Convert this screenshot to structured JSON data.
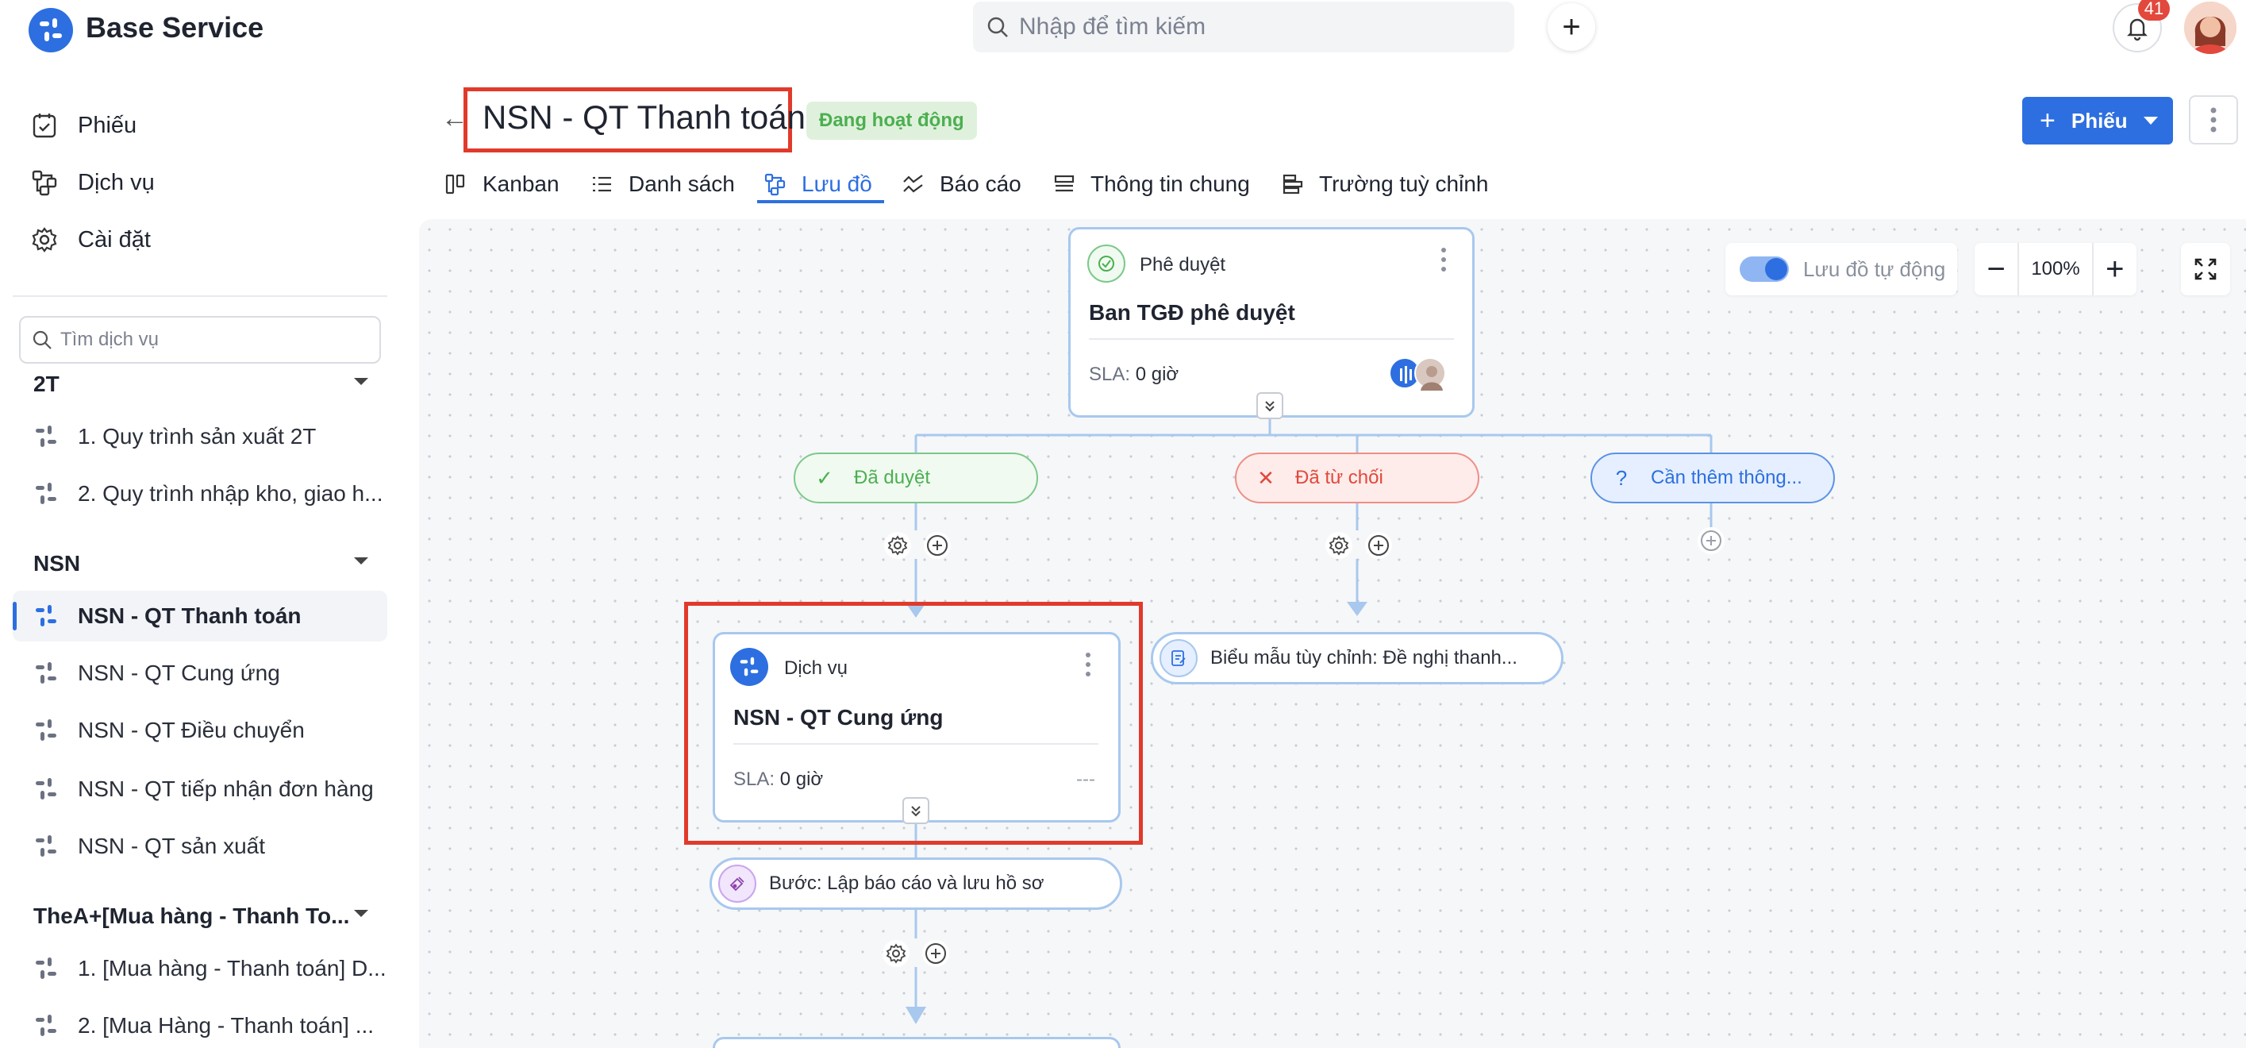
{
  "app": {
    "title": "Base Service"
  },
  "search": {
    "placeholder": "Nhập để tìm kiếm"
  },
  "notifications": {
    "count": "41"
  },
  "sidebar": {
    "nav": [
      {
        "label": "Phiếu",
        "icon": "ticket-icon"
      },
      {
        "label": "Dịch vụ",
        "icon": "service-icon"
      },
      {
        "label": "Cài đặt",
        "icon": "gear-icon"
      }
    ],
    "search_placeholder": "Tìm dịch vụ",
    "groups": [
      {
        "name": "2T",
        "items": [
          "1. Quy trình sản xuất 2T",
          "2. Quy trình nhập kho, giao h..."
        ]
      },
      {
        "name": "NSN",
        "items": [
          "NSN - QT Thanh toán",
          "NSN - QT Cung ứng",
          "NSN - QT Điều chuyển",
          "NSN - QT tiếp nhận đơn hàng",
          "NSN - QT sản xuất"
        ]
      },
      {
        "name": "TheA+[Mua hàng - Thanh To...",
        "items": [
          "1. [Mua hàng - Thanh toán] D...",
          "2. [Mua Hàng - Thanh toán] ..."
        ]
      }
    ],
    "active_item": "NSN - QT Thanh toán"
  },
  "header": {
    "title": "NSN - QT Thanh toán",
    "status": "Đang hoạt động",
    "primary_button": "Phiếu"
  },
  "tabs": [
    {
      "label": "Kanban",
      "icon": "kanban-icon"
    },
    {
      "label": "Danh sách",
      "icon": "list-icon"
    },
    {
      "label": "Lưu đồ",
      "icon": "flow-icon"
    },
    {
      "label": "Báo cáo",
      "icon": "report-icon"
    },
    {
      "label": "Thông tin chung",
      "icon": "info-icon"
    },
    {
      "label": "Trường tuỳ chỉnh",
      "icon": "custom-field-icon"
    }
  ],
  "active_tab": "Lưu đồ",
  "flow_controls": {
    "auto_layout_label": "Lưu đồ tự động",
    "auto_layout_on": true,
    "zoom": "100%"
  },
  "flow": {
    "approval_node": {
      "type": "Phê duyệt",
      "name": "Ban TGĐ phê duyệt",
      "sla_label": "SLA:",
      "sla_value": "0 giờ"
    },
    "branches": [
      {
        "label": "Đã duyệt",
        "color": "#4caf50"
      },
      {
        "label": "Đã từ chối",
        "color": "#e2483c"
      },
      {
        "label": "Cần thêm thông...",
        "color": "#2d6fe0"
      }
    ],
    "service_node": {
      "type": "Dịch vụ",
      "name": "NSN - QT Cung ứng",
      "sla_label": "SLA:",
      "sla_value": "0 giờ",
      "assignee": "---"
    },
    "form_node": {
      "label": "Biểu mẫu tùy chỉnh: Đề nghị thanh..."
    },
    "step_node": {
      "label": "Bước: Lập báo cáo và lưu hồ sơ"
    }
  },
  "colors": {
    "accent": "#2d6fe0",
    "highlight": "#e13a2b"
  }
}
